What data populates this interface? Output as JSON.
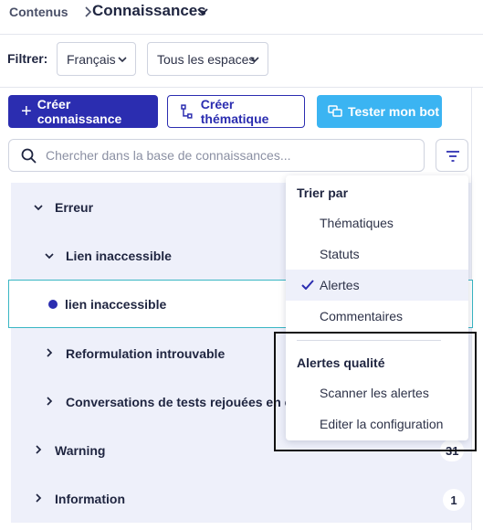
{
  "breadcrumb": {
    "root": "Contenus",
    "title": "Connaissances"
  },
  "filters": {
    "label": "Filtrer:",
    "language": "Français",
    "space": "Tous les espaces"
  },
  "actions": {
    "create": "Créer connaissance",
    "create_theme": "Créer thématique",
    "test_bot": "Tester mon bot"
  },
  "search": {
    "placeholder": "Chercher dans la base de connaissances..."
  },
  "tree": {
    "items": [
      {
        "label": "Erreur"
      },
      {
        "label": "Lien inaccessible"
      },
      {
        "label": "lien inaccessible"
      },
      {
        "label": "Reformulation introuvable"
      },
      {
        "label": "Conversations de tests rejouées en échec"
      },
      {
        "label": "Warning",
        "count": "31"
      },
      {
        "label": "Information",
        "count": "1"
      }
    ]
  },
  "sort_menu": {
    "heading": "Trier par",
    "options": [
      "Thématiques",
      "Statuts",
      "Alertes",
      "Commentaires"
    ],
    "selected": "Alertes",
    "quality_heading": "Alertes qualité",
    "quality_actions": [
      "Scanner les alertes",
      "Editer la configuration"
    ]
  },
  "colors": {
    "primary": "#2b2db0",
    "accent": "#3bb4f2",
    "selection_border": "#39b6c4",
    "tree_bg": "#eef0fa"
  }
}
